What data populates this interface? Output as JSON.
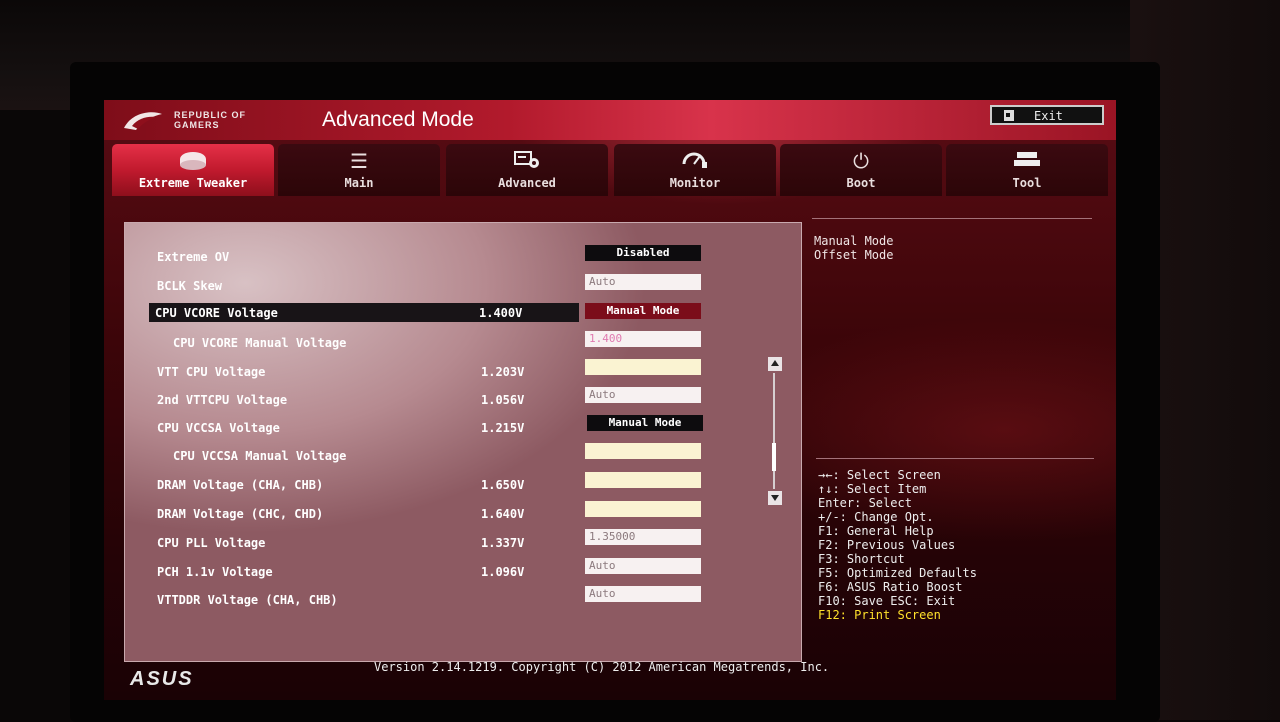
{
  "header": {
    "brand_text": "REPUBLIC OF GAMERS",
    "title": "Advanced Mode",
    "exit_label": "Exit"
  },
  "tabs": [
    {
      "label": "Extreme Tweaker",
      "icon": "dial-icon",
      "active": true
    },
    {
      "label": "Main",
      "icon": "list-icon",
      "active": false
    },
    {
      "label": "Advanced",
      "icon": "advanced-settings-icon",
      "active": false
    },
    {
      "label": "Monitor",
      "icon": "monitor-gauge-icon",
      "active": false
    },
    {
      "label": "Boot",
      "icon": "power-icon",
      "active": false
    },
    {
      "label": "Tool",
      "icon": "tool-icon",
      "active": false
    }
  ],
  "settings": [
    {
      "label": "Extreme OV",
      "value": "",
      "control": "Disabled"
    },
    {
      "label": "BCLK Skew",
      "value": "",
      "control": "Auto"
    },
    {
      "label": "CPU VCORE Voltage",
      "value": "1.400V",
      "control": "Manual Mode"
    },
    {
      "label": "CPU VCORE Manual Voltage",
      "value": "",
      "control": "1.400"
    },
    {
      "label": "VTT CPU Voltage",
      "value": "1.203V",
      "control": ""
    },
    {
      "label": "2nd VTTCPU Voltage",
      "value": "1.056V",
      "control": "Auto"
    },
    {
      "label": "CPU VCCSA Voltage",
      "value": "1.215V",
      "control": "Manual Mode"
    },
    {
      "label": "CPU VCCSA Manual Voltage",
      "value": "",
      "control": ""
    },
    {
      "label": "DRAM Voltage (CHA, CHB)",
      "value": "1.650V",
      "control": ""
    },
    {
      "label": "DRAM Voltage (CHC, CHD)",
      "value": "1.640V",
      "control": ""
    },
    {
      "label": "CPU PLL Voltage",
      "value": "1.337V",
      "control": "1.35000"
    },
    {
      "label": "PCH 1.1v Voltage",
      "value": "1.096V",
      "control": "Auto"
    },
    {
      "label": "VTTDDR Voltage (CHA, CHB)",
      "value": "",
      "control": "Auto"
    }
  ],
  "help_options": [
    "Manual Mode",
    "Offset Mode"
  ],
  "key_help": [
    "→←: Select Screen",
    "↑↓: Select Item",
    "Enter: Select",
    "+/-: Change Opt.",
    "F1: General Help",
    "F2: Previous Values",
    "F3: Shortcut",
    "F5: Optimized Defaults",
    "F6: ASUS Ratio Boost",
    "F10: Save  ESC: Exit",
    "F12: Print Screen"
  ],
  "footer": {
    "version": "Version 2.14.1219. Copyright (C) 2012 American Megatrends, Inc.",
    "asus_logo": "ASUS"
  },
  "colors": {
    "accent_red": "#c11a2e",
    "highlight_key": "#ffe12b"
  }
}
